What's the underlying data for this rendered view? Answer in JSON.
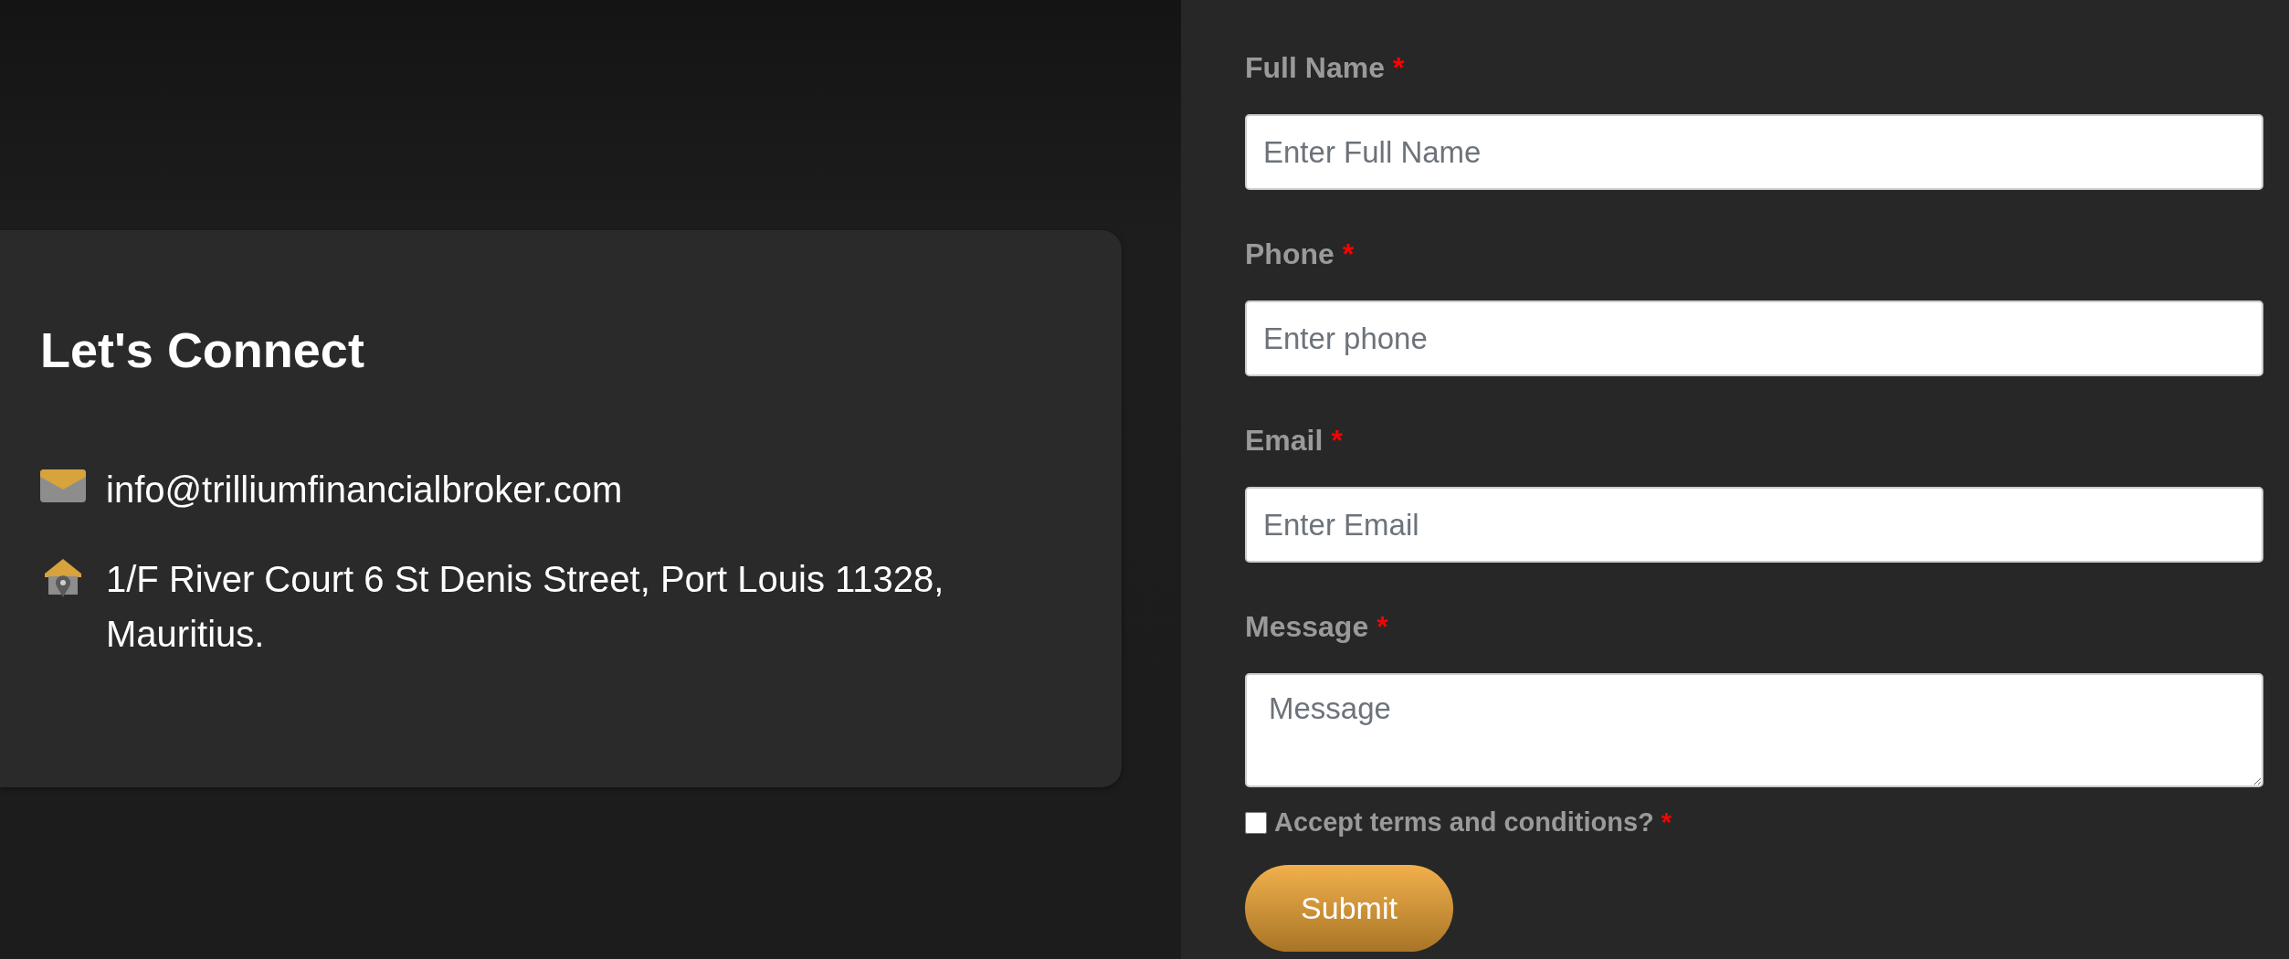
{
  "contact": {
    "title": "Let's Connect",
    "items": [
      {
        "kind": "email",
        "text": "info@trilliumfinancialbroker.com"
      },
      {
        "kind": "address",
        "text": "1/F River Court 6 St Denis Street, Port Louis 11328, Mauritius."
      }
    ]
  },
  "form": {
    "fields": [
      {
        "kind": "input",
        "label": "Full Name",
        "required_mark": "*",
        "placeholder": "Enter Full Name"
      },
      {
        "kind": "input",
        "label": "Phone",
        "required_mark": "*",
        "placeholder": "Enter phone"
      },
      {
        "kind": "input",
        "label": "Email",
        "required_mark": "*",
        "placeholder": "Enter Email"
      },
      {
        "kind": "textarea",
        "label": "Message",
        "required_mark": "*",
        "placeholder": "Message"
      }
    ],
    "terms": {
      "label": "Accept terms and conditions?",
      "required_mark": "*",
      "checked": false
    },
    "submit": "Submit"
  }
}
